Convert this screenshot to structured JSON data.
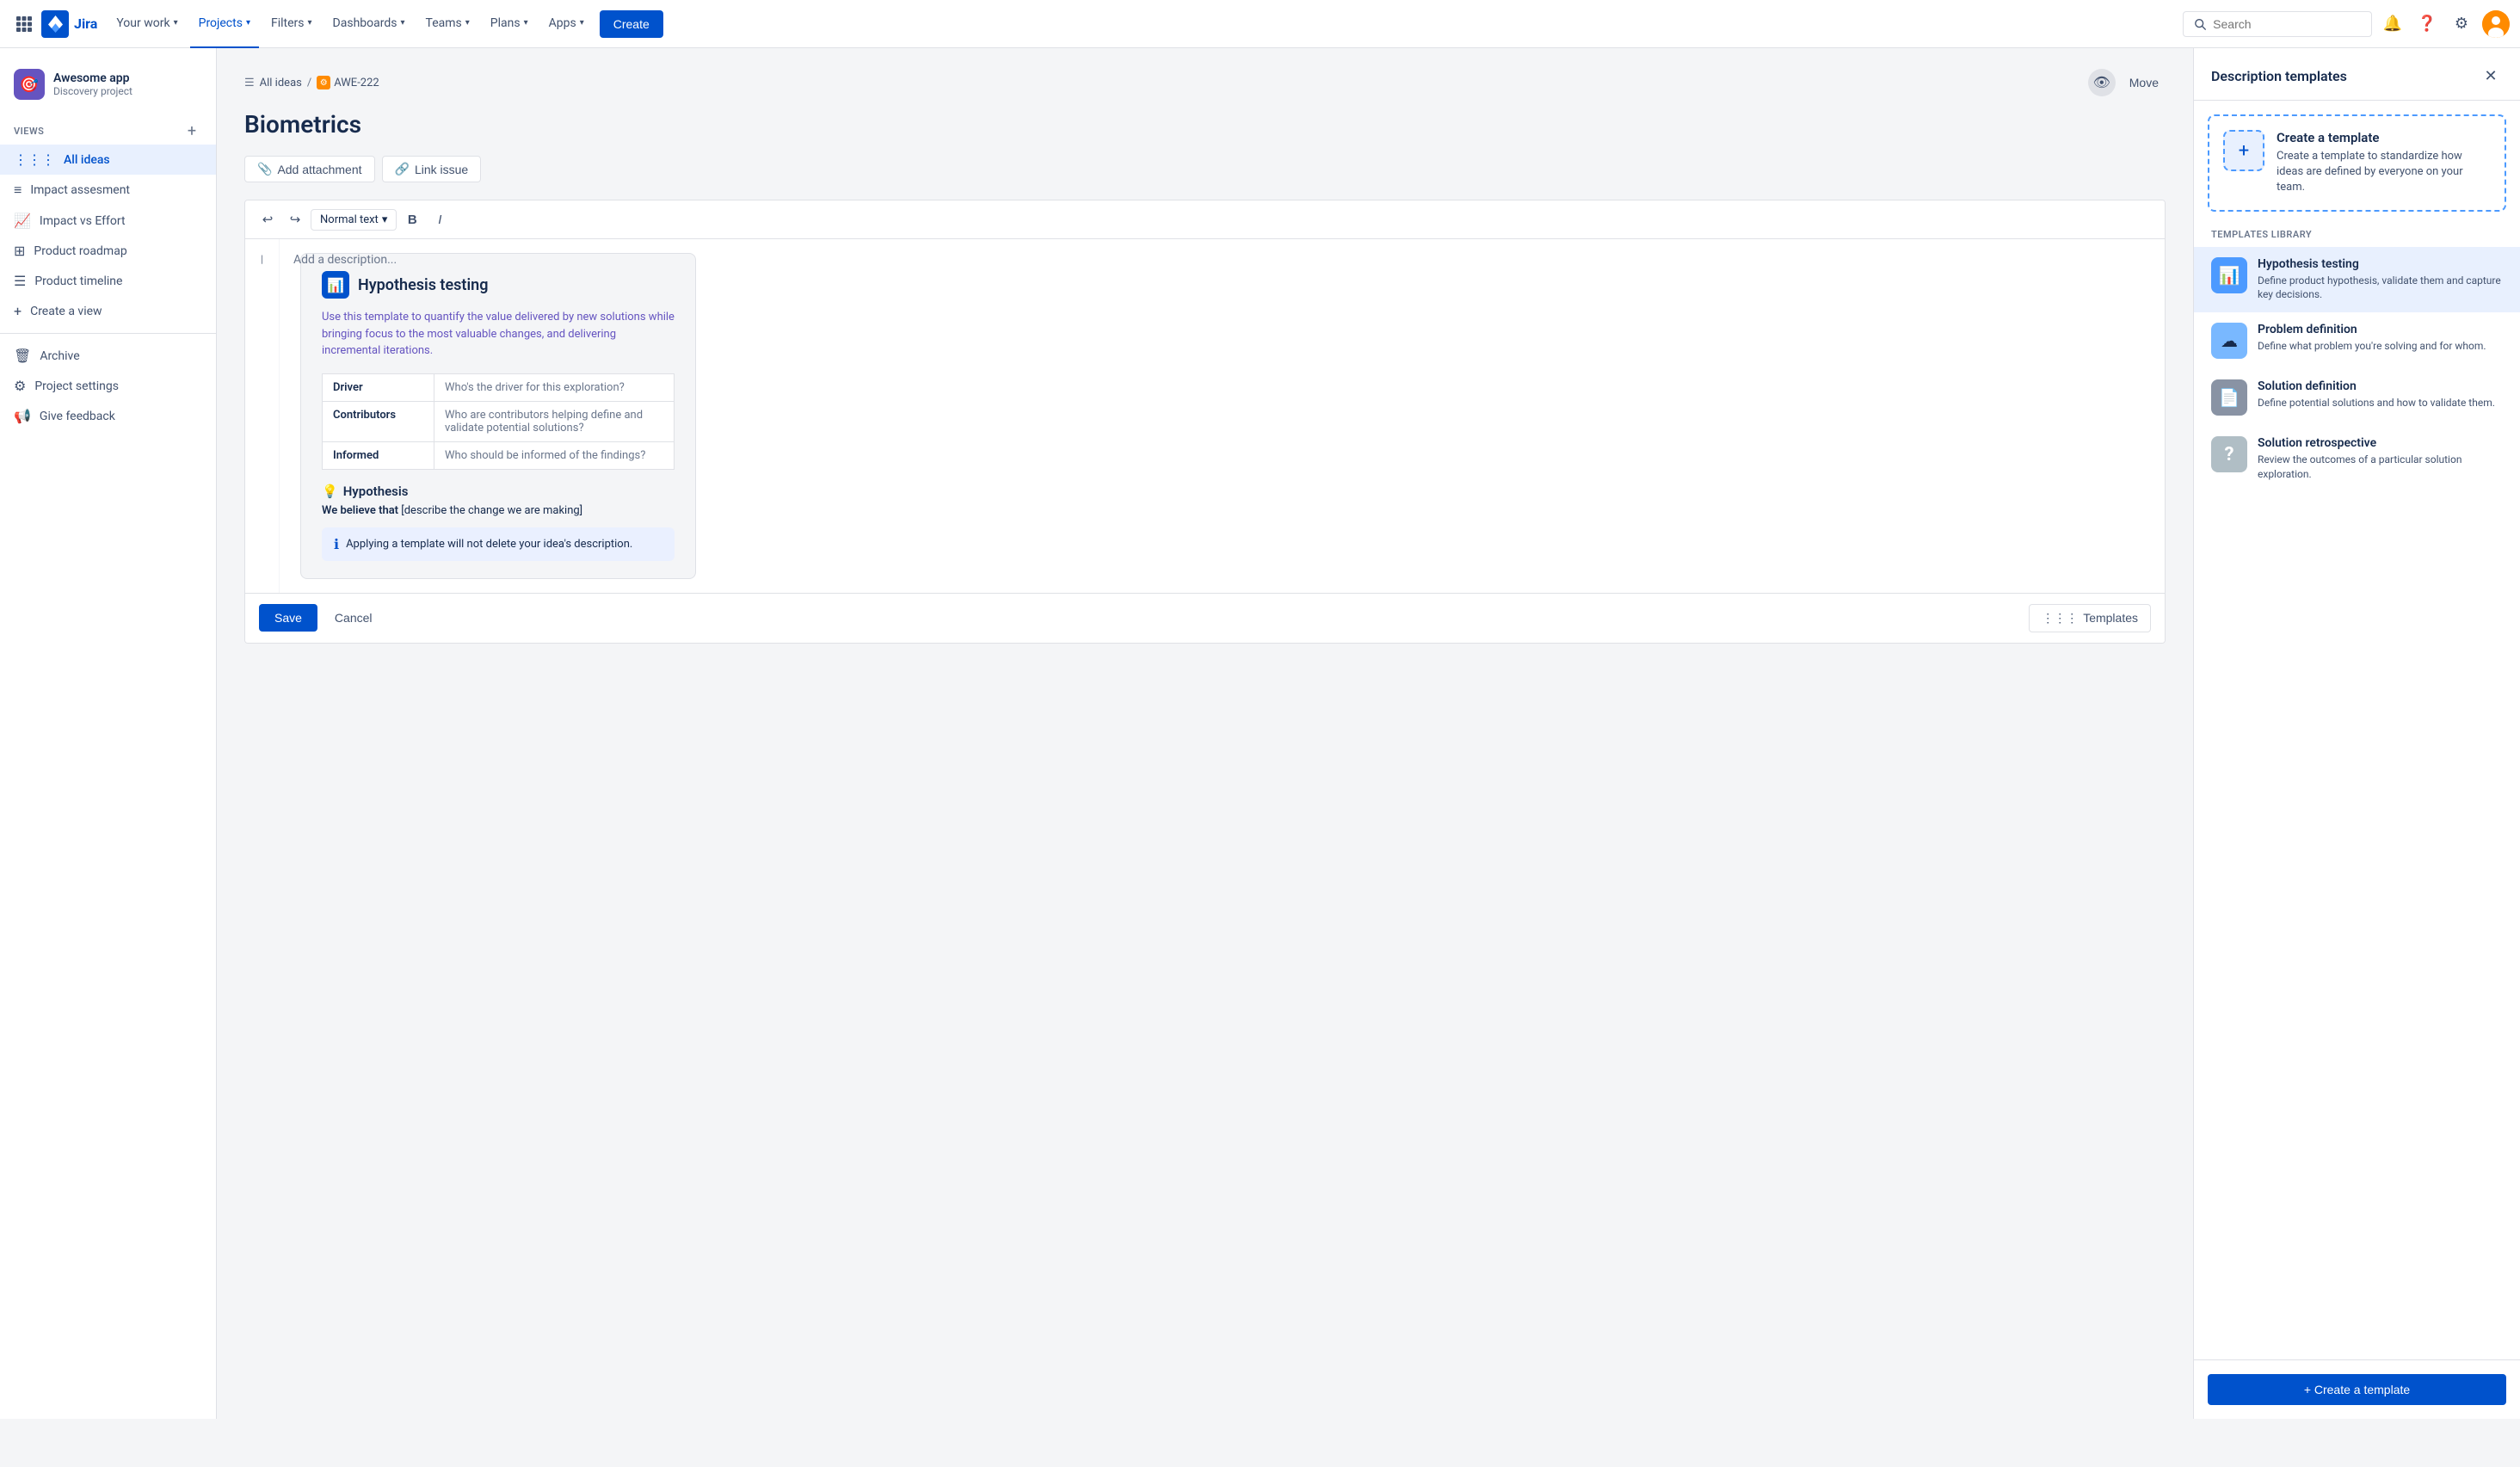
{
  "nav": {
    "logo_text": "Jira",
    "items": [
      {
        "id": "your-work",
        "label": "Your work",
        "has_chevron": true,
        "active": false
      },
      {
        "id": "projects",
        "label": "Projects",
        "has_chevron": true,
        "active": true
      },
      {
        "id": "filters",
        "label": "Filters",
        "has_chevron": true,
        "active": false
      },
      {
        "id": "dashboards",
        "label": "Dashboards",
        "has_chevron": true,
        "active": false
      },
      {
        "id": "teams",
        "label": "Teams",
        "has_chevron": true,
        "active": false
      },
      {
        "id": "plans",
        "label": "Plans",
        "has_chevron": true,
        "active": false
      },
      {
        "id": "apps",
        "label": "Apps",
        "has_chevron": true,
        "active": false
      }
    ],
    "create_label": "Create",
    "search_placeholder": "Search"
  },
  "sidebar": {
    "project_name": "Awesome app",
    "project_type": "Discovery project",
    "views_label": "VIEWS",
    "items": [
      {
        "id": "all-ideas",
        "label": "All ideas",
        "icon": "⋮⋮⋮",
        "active": true
      },
      {
        "id": "impact-assessment",
        "label": "Impact assesment",
        "icon": "≡",
        "active": false
      },
      {
        "id": "impact-vs-effort",
        "label": "Impact vs Effort",
        "icon": "📈",
        "active": false
      },
      {
        "id": "product-roadmap",
        "label": "Product roadmap",
        "icon": "⊞",
        "active": false
      },
      {
        "id": "product-timeline",
        "label": "Product timeline",
        "icon": "☰",
        "active": false
      },
      {
        "id": "create-view",
        "label": "Create a view",
        "icon": "+",
        "active": false
      }
    ],
    "bottom_items": [
      {
        "id": "archive",
        "label": "Archive",
        "icon": "🗑"
      },
      {
        "id": "project-settings",
        "label": "Project settings",
        "icon": "⚙"
      },
      {
        "id": "give-feedback",
        "label": "Give feedback",
        "icon": "📢"
      }
    ]
  },
  "breadcrumb": {
    "all_ideas": "All ideas",
    "issue_id": "AWE-222"
  },
  "page": {
    "title": "Biometrics",
    "add_attachment_label": "Add attachment",
    "link_issue_label": "Link issue",
    "move_label": "Move"
  },
  "editor": {
    "undo_label": "undo",
    "redo_label": "redo",
    "text_style_label": "Normal text",
    "bold_label": "B",
    "italic_label": "I",
    "placeholder": "Add a description...",
    "save_label": "Save",
    "cancel_label": "Cancel",
    "templates_label": "Templates"
  },
  "template_preview": {
    "title": "Hypothesis testing",
    "description": "Use this template to quantify the value delivered by new solutions while bringing focus to the most valuable changes, and delivering incremental iterations.",
    "table_rows": [
      {
        "label": "Driver",
        "value": "Who's the driver for this exploration?"
      },
      {
        "label": "Contributors",
        "value": "Who are contributors helping define and validate potential solutions?"
      },
      {
        "label": "Informed",
        "value": "Who should be informed of the findings?"
      }
    ],
    "hypothesis_title": "Hypothesis",
    "hypothesis_text_bold": "We believe that",
    "hypothesis_text": " [describe the change we are making]",
    "info_text": "Applying a template will not delete your idea's description."
  },
  "right_panel": {
    "title": "Description templates",
    "create_template_title": "Create a template",
    "create_template_desc": "Create a template to standardize how ideas are defined by everyone on your team.",
    "library_label": "TEMPLATES LIBRARY",
    "templates": [
      {
        "id": "hypothesis-testing",
        "title": "Hypothesis testing",
        "desc": "Define product hypothesis, validate them and capture key decisions.",
        "icon": "📊",
        "icon_color": "lib-icon-blue",
        "active": true
      },
      {
        "id": "problem-definition",
        "title": "Problem definition",
        "desc": "Define what problem you're solving and for whom.",
        "icon": "☁",
        "icon_color": "lib-icon-light-blue",
        "active": false
      },
      {
        "id": "solution-definition",
        "title": "Solution definition",
        "desc": "Define potential solutions and how to validate them.",
        "icon": "📄",
        "icon_color": "lib-icon-slate",
        "active": false
      },
      {
        "id": "solution-retrospective",
        "title": "Solution retrospective",
        "desc": "Review the outcomes of a particular solution exploration.",
        "icon": "?",
        "icon_color": "lib-icon-grey",
        "active": false
      }
    ],
    "footer_create_label": "+ Create a template"
  }
}
